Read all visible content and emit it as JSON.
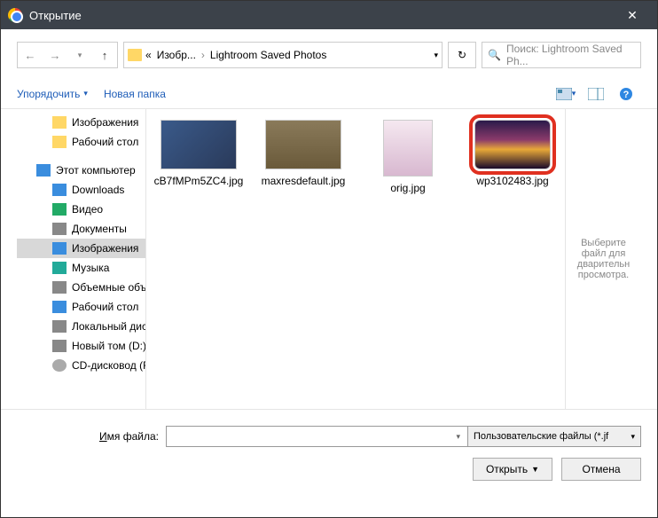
{
  "title": "Открытие",
  "breadcrumb": {
    "seg1": "Изобр...",
    "seg2": "Lightroom Saved Photos"
  },
  "search": {
    "placeholder": "Поиск: Lightroom Saved Ph..."
  },
  "toolbar": {
    "organize": "Упорядочить",
    "new_folder": "Новая папка"
  },
  "tree": {
    "images": "Изображения",
    "desktop": "Рабочий стол",
    "this_pc": "Этот компьютер",
    "downloads": "Downloads",
    "video": "Видео",
    "documents": "Документы",
    "images2": "Изображения",
    "music": "Музыка",
    "volumes": "Объемные объ",
    "desktop2": "Рабочий стол",
    "local_disk": "Локальный дис",
    "new_vol": "Новый том (D:)",
    "cd": "CD-дисковод (F"
  },
  "files": {
    "f1": "cB7fMPm5ZC4.jpg",
    "f2": "maxresdefault.jpg",
    "f3": "orig.jpg",
    "f4": "wp3102483.jpg"
  },
  "preview_hint": "Выберите файл для дварительн просмотра.",
  "footer": {
    "filename_label": "Имя файла:",
    "file_type": "Пользовательские файлы (*.jf",
    "open": "Открыть",
    "cancel": "Отмена"
  }
}
